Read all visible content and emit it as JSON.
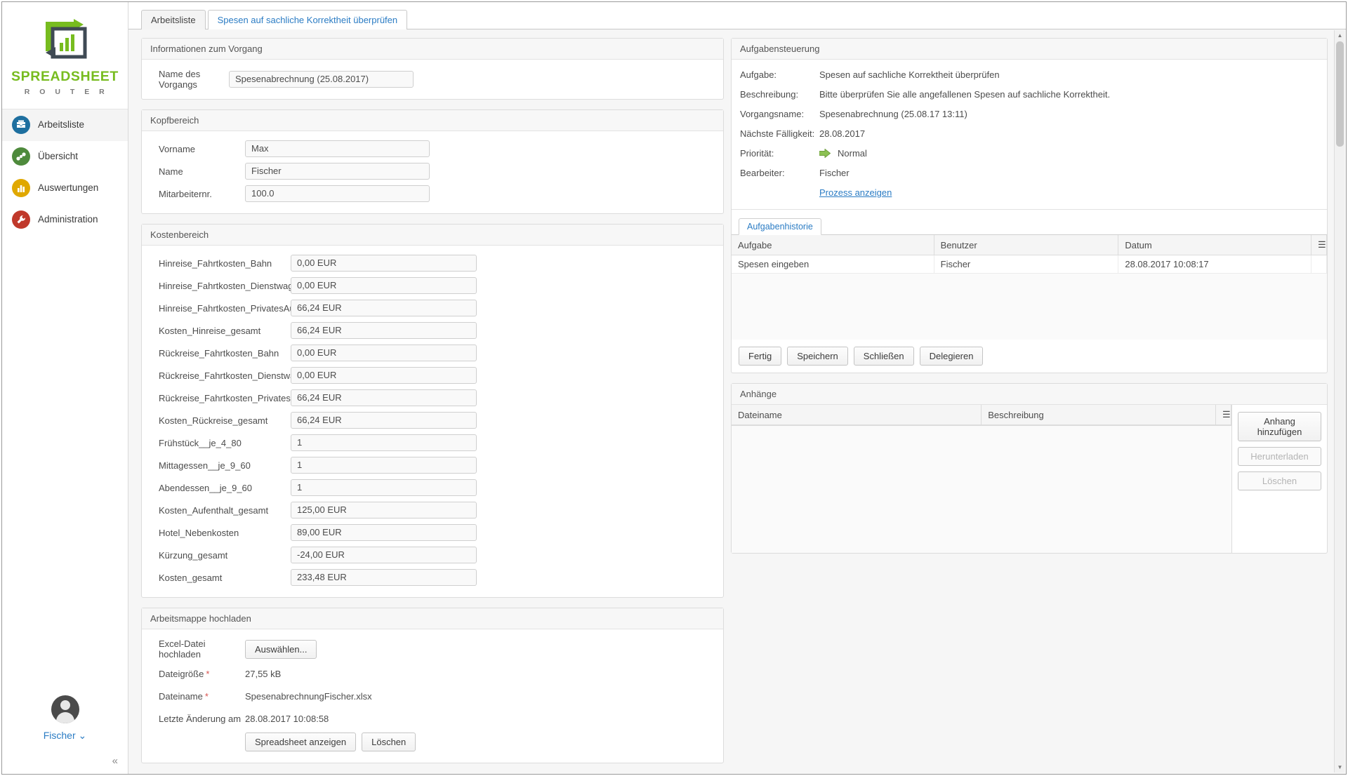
{
  "brand": {
    "name": "SPREADSHEET",
    "sub": "R O U T E R",
    "green": "#77bc1f",
    "dark": "#3f4a54"
  },
  "sidebar": {
    "items": [
      {
        "label": "Arbeitsliste",
        "icon": "inbox-icon",
        "active": true
      },
      {
        "label": "Übersicht",
        "icon": "network-icon",
        "active": false
      },
      {
        "label": "Auswertungen",
        "icon": "bar-chart-icon",
        "active": false
      },
      {
        "label": "Administration",
        "icon": "wrench-icon",
        "active": false
      }
    ],
    "user": {
      "name": "Fischer",
      "caret": "⌄"
    },
    "collapse": "«"
  },
  "tabs": [
    {
      "label": "Arbeitsliste",
      "active": false
    },
    {
      "label": "Spesen auf sachliche Korrektheit überprüfen",
      "active": true
    }
  ],
  "vorgang_panel": {
    "title": "Informationen zum Vorgang",
    "name_label": "Name des Vorgangs",
    "name_value": "Spesenabrechnung (25.08.2017)"
  },
  "kopf_panel": {
    "title": "Kopfbereich",
    "rows": [
      {
        "label": "Vorname",
        "value": "Max"
      },
      {
        "label": "Name",
        "value": "Fischer"
      },
      {
        "label": "Mitarbeiternr.",
        "value": "100.0"
      }
    ]
  },
  "kosten_panel": {
    "title": "Kostenbereich",
    "rows": [
      {
        "label": "Hinreise_Fahrtkosten_Bahn",
        "value": "0,00 EUR"
      },
      {
        "label": "Hinreise_Fahrtkosten_Dienstwagen",
        "value": "0,00 EUR"
      },
      {
        "label": "Hinreise_Fahrtkosten_PrivatesAuto",
        "value": "66,24 EUR"
      },
      {
        "label": "Kosten_Hinreise_gesamt",
        "value": "66,24 EUR"
      },
      {
        "label": "Rückreise_Fahrtkosten_Bahn",
        "value": "0,00 EUR"
      },
      {
        "label": "Rückreise_Fahrtkosten_Dienstwagen",
        "value": "0,00 EUR"
      },
      {
        "label": "Rückreise_Fahrtkosten_PrivatesAuto",
        "value": "66,24 EUR"
      },
      {
        "label": "Kosten_Rückreise_gesamt",
        "value": "66,24 EUR"
      },
      {
        "label": "Frühstück__je_4_80",
        "value": "1"
      },
      {
        "label": "Mittagessen__je_9_60",
        "value": "1"
      },
      {
        "label": "Abendessen__je_9_60",
        "value": "1"
      },
      {
        "label": "Kosten_Aufenthalt_gesamt",
        "value": "125,00 EUR"
      },
      {
        "label": "Hotel_Nebenkosten",
        "value": "89,00 EUR"
      },
      {
        "label": "Kürzung_gesamt",
        "value": "-24,00 EUR"
      },
      {
        "label": "Kosten_gesamt",
        "value": "233,48 EUR"
      }
    ]
  },
  "upload_panel": {
    "title": "Arbeitsmappe hochladen",
    "upload_label": "Excel-Datei hochladen",
    "choose_button": "Auswählen...",
    "filesize_label": "Dateigröße",
    "filesize_value": "27,55 kB",
    "filename_label": "Dateiname",
    "filename_value": "SpesenabrechnungFischer.xlsx",
    "modified_label": "Letzte Änderung am",
    "modified_value": "28.08.2017 10:08:58",
    "show_button": "Spreadsheet anzeigen",
    "delete_button": "Löschen",
    "required_mark": "*"
  },
  "task_panel": {
    "title": "Aufgabensteuerung",
    "rows": [
      {
        "term": "Aufgabe:",
        "desc": "Spesen auf sachliche Korrektheit überprüfen"
      },
      {
        "term": "Beschreibung:",
        "desc": "Bitte überprüfen Sie alle angefallenen Spesen auf sachliche Korrektheit."
      },
      {
        "term": "Vorgangsname:",
        "desc": "Spesenabrechnung (25.08.17 13:11)"
      },
      {
        "term": "Nächste Fälligkeit:",
        "desc": "28.08.2017"
      }
    ],
    "priority_label": "Priorität:",
    "priority_value": "Normal",
    "priority_color": "#7cb342",
    "editor_label": "Bearbeiter:",
    "editor_value": "Fischer",
    "process_link": "Prozess anzeigen",
    "history_tab": "Aufgabenhistorie",
    "history_columns": [
      "Aufgabe",
      "Benutzer",
      "Datum"
    ],
    "history_rows": [
      {
        "aufgabe": "Spesen eingeben",
        "benutzer": "Fischer",
        "datum": "28.08.2017 10:08:17"
      }
    ],
    "buttons": [
      {
        "label": "Fertig",
        "enabled": true
      },
      {
        "label": "Speichern",
        "enabled": true
      },
      {
        "label": "Schließen",
        "enabled": true
      },
      {
        "label": "Delegieren",
        "enabled": true
      }
    ],
    "column_menu_icon": "hamburger-icon"
  },
  "attachments_panel": {
    "title": "Anhänge",
    "columns": [
      "Dateiname",
      "Beschreibung"
    ],
    "rows": [],
    "buttons": [
      {
        "label": "Anhang hinzufügen",
        "enabled": true
      },
      {
        "label": "Herunterladen",
        "enabled": false
      },
      {
        "label": "Löschen",
        "enabled": false
      }
    ],
    "column_menu_icon": "hamburger-icon"
  },
  "scrollbar": {
    "up": "▲",
    "down": "▼"
  }
}
